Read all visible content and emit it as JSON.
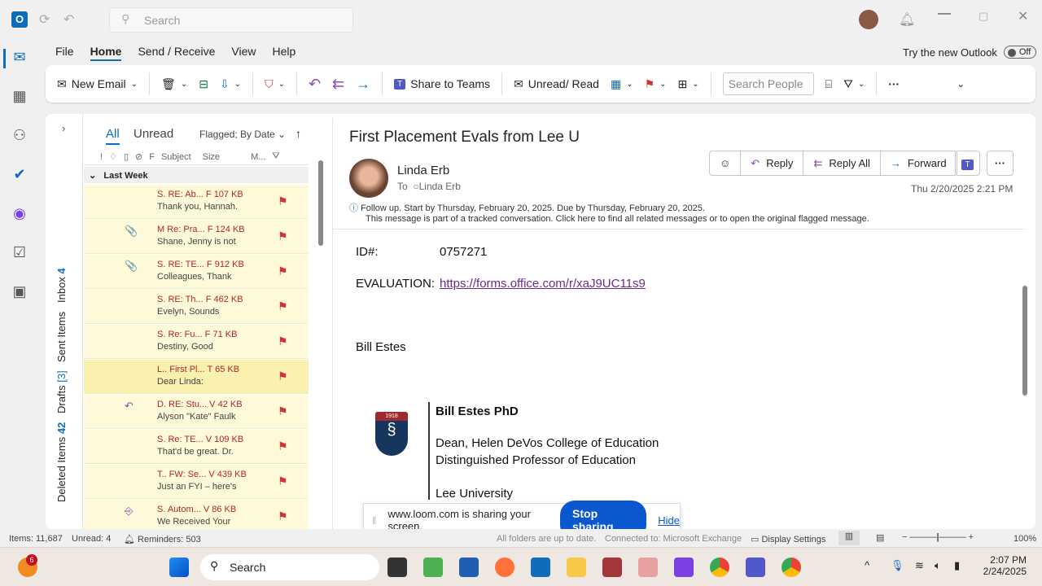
{
  "titlebar": {
    "search_placeholder": "Search"
  },
  "menu": {
    "tabs": [
      "File",
      "Home",
      "Send / Receive",
      "View",
      "Help"
    ],
    "try_new": "Try the new Outlook",
    "toggle": "Off"
  },
  "ribbon": {
    "new_email": "New Email",
    "share_teams": "Share to Teams",
    "unread_read": "Unread/ Read",
    "search_people": "Search People"
  },
  "folders": {
    "inbox": "Inbox",
    "inbox_count": "4",
    "sent": "Sent Items",
    "drafts": "Drafts",
    "drafts_count": "[3]",
    "deleted": "Deleted Items",
    "deleted_count": "42"
  },
  "list": {
    "tab_all": "All",
    "tab_unread": "Unread",
    "sort": "Flagged; By Date",
    "col_f": "F",
    "col_subject": "Subject",
    "col_size": "Size",
    "col_m": "M...",
    "group": "Last Week",
    "rows": [
      {
        "l1": "S. RE: Ab...  F  107 KB",
        "l2": "Thank you, Hannah.",
        "icon": ""
      },
      {
        "l1": "M Re: Pra...  F  124 KB",
        "l2": "Shane, Jenny is not",
        "icon": "📎"
      },
      {
        "l1": "S. RE: TE...  F  912 KB",
        "l2": "Colleagues,  Thank",
        "icon": "📎"
      },
      {
        "l1": "S. RE: Th...  F  462 KB",
        "l2": "Evelyn,  Sounds",
        "icon": ""
      },
      {
        "l1": "S. Re: Fu...  F  71 KB",
        "l2": "Destiny,  Good",
        "icon": ""
      },
      {
        "l1": "L.. First Pl...  T  65 KB",
        "l2": "Dear Linda:",
        "icon": ""
      },
      {
        "l1": "D. RE: Stu...  V  42 KB",
        "l2": "Alyson \"Kate\" Faulk",
        "icon": "↶"
      },
      {
        "l1": "S. Re: TE...  V  109 KB",
        "l2": "That'd be great.  Dr.",
        "icon": ""
      },
      {
        "l1": "T.. FW: Se...  V  439 KB",
        "l2": "Just an FYI – here's",
        "icon": ""
      },
      {
        "l1": "S. Autom...  V  86 KB",
        "l2": "We Received Your",
        "icon": "⎆"
      }
    ]
  },
  "message": {
    "subject": "First Placement Evals from Lee U",
    "sender": "Linda Erb",
    "to_label": "To",
    "to": "Linda Erb",
    "date": "Thu 2/20/2025 2:21 PM",
    "reply": "Reply",
    "reply_all": "Reply All",
    "forward": "Forward",
    "followup": "Follow up.  Start by Thursday, February 20, 2025.  Due by Thursday, February 20, 2025.",
    "tracked": "This message is part of a tracked conversation. Click here to find all related messages or to open the original flagged message.",
    "id_label": "ID#:",
    "id_value": "0757271",
    "eval_label": "EVALUATION:",
    "eval_link": "https://forms.office.com/r/xaJ9UC11s9",
    "signoff": "Bill Estes",
    "sig_name": "Bill Estes PhD",
    "sig_title1": "Dean, Helen DeVos College of Education",
    "sig_title2": "Distinguished Professor of Education",
    "sig_org": "Lee University",
    "logo_year": "1918"
  },
  "loom": {
    "text": "www.loom.com is sharing your screen.",
    "stop": "Stop sharing",
    "hide": "Hide"
  },
  "status": {
    "items": "Items: 11,687",
    "unread": "Unread: 4",
    "reminders": "Reminders: 503",
    "sync": "All folders are up to date.",
    "connected": "Connected to: Microsoft Exchange",
    "display": "Display Settings",
    "zoom": "100%"
  },
  "taskbar": {
    "badge": "6",
    "search": "Search",
    "time": "2:07 PM",
    "date": "2/24/2025"
  }
}
